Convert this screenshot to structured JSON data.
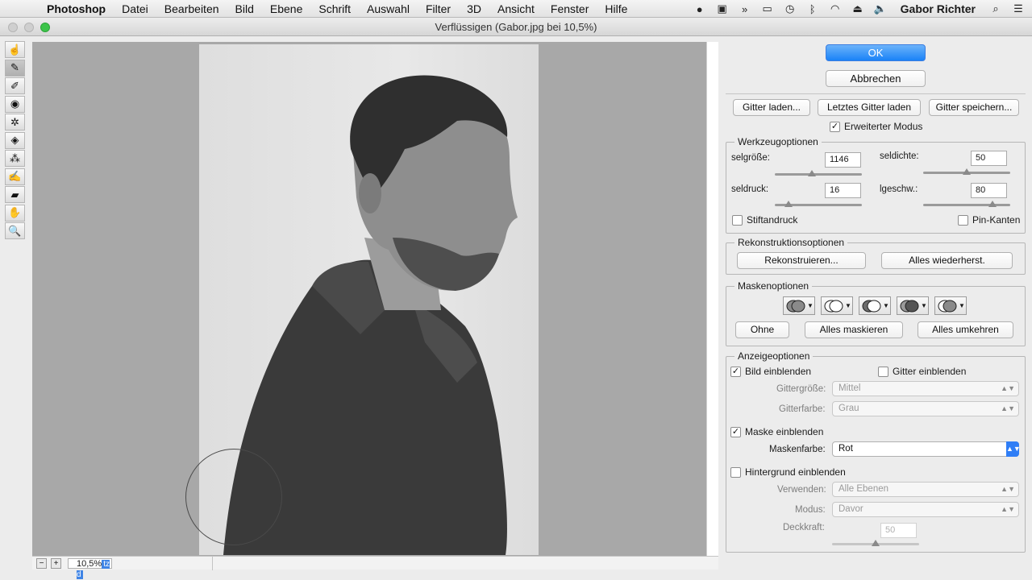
{
  "menubar": {
    "app_name": "Photoshop",
    "items": [
      "Datei",
      "Bearbeiten",
      "Bild",
      "Ebene",
      "Schrift",
      "Auswahl",
      "Filter",
      "3D",
      "Ansicht",
      "Fenster",
      "Hilfe"
    ],
    "user_name": "Gabor Richter"
  },
  "window": {
    "title": "Verflüssigen (Gabor.jpg bei 10,5%)"
  },
  "canvas": {
    "zoom_value": "10,5%",
    "zoom_selection_text": "tz d"
  },
  "panel": {
    "ok_label": "OK",
    "cancel_label": "Abbrechen",
    "load_mesh": "Gitter laden...",
    "load_last_mesh": "Letztes Gitter laden",
    "save_mesh": "Gitter speichern...",
    "advanced_mode": "Erweiterter Modus",
    "tool_options": {
      "title": "Werkzeugoptionen",
      "brush_size_label": "selgröße:",
      "brush_size": "1146",
      "brush_density_label": "seldichte:",
      "brush_density": "50",
      "brush_pressure_label": "seldruck:",
      "brush_pressure": "16",
      "brush_rate_label": "lgeschw.:",
      "brush_rate": "80",
      "stylus_pressure": "Stiftandruck",
      "pin_edges": "Pin-Kanten"
    },
    "reconstruct_options": {
      "title": "Rekonstruktionsoptionen",
      "reconstruct": "Rekonstruieren...",
      "restore_all": "Alles wiederherst."
    },
    "mask_options": {
      "title": "Maskenoptionen",
      "none": "Ohne",
      "mask_all": "Alles maskieren",
      "invert_all": "Alles umkehren"
    },
    "view_options": {
      "title": "Anzeigeoptionen",
      "show_image": "Bild einblenden",
      "show_mesh": "Gitter einblenden",
      "mesh_size_label": "Gittergröße:",
      "mesh_size": "Mittel",
      "mesh_color_label": "Gitterfarbe:",
      "mesh_color": "Grau",
      "show_mask": "Maske einblenden",
      "mask_color_label": "Maskenfarbe:",
      "mask_color": "Rot",
      "show_backdrop": "Hintergrund einblenden",
      "use_label": "Verwenden:",
      "use_value": "Alle Ebenen",
      "mode_label": "Modus:",
      "mode_value": "Davor",
      "opacity_label": "Deckkraft:",
      "opacity_value": "50"
    }
  },
  "sliders": {
    "brush_size": 0.43,
    "brush_density": 0.5,
    "brush_pressure": 0.16,
    "brush_rate": 0.8,
    "opacity": 0.5
  },
  "checkbox_states": {
    "advanced_mode": true,
    "stylus_pressure": false,
    "pin_edges": false,
    "show_image": true,
    "show_mesh": false,
    "show_mask": true,
    "show_backdrop": false
  },
  "icons": {
    "tools": [
      "forward-warp-tool-icon",
      "reconstruct-tool-icon",
      "smooth-tool-icon",
      "twirl-clockwise-tool-icon",
      "pucker-tool-icon",
      "bloat-tool-icon",
      "push-left-tool-icon",
      "freeze-mask-tool-icon",
      "thaw-mask-tool-icon",
      "hand-tool-icon",
      "zoom-tool-icon"
    ]
  },
  "colors": {
    "accent": "#1a82f7",
    "canvas_bg": "#a8a8a8"
  }
}
